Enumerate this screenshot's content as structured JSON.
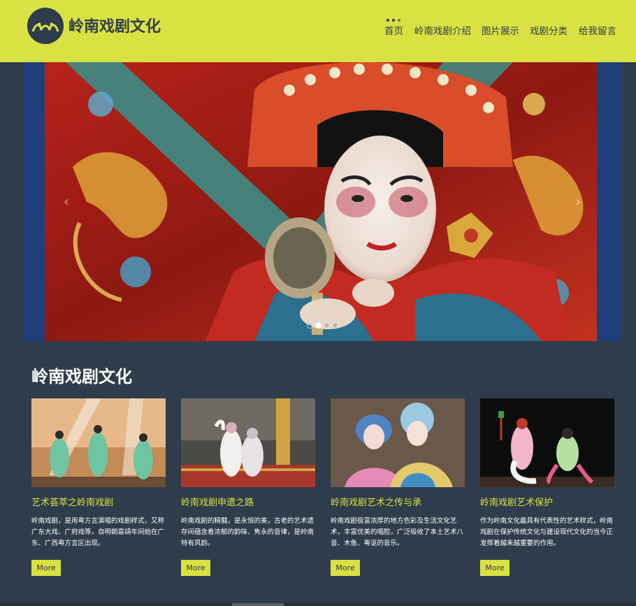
{
  "site": {
    "title": "岭南戏剧文化"
  },
  "nav": {
    "items": [
      "首页",
      "岭南戏剧介绍",
      "图片展示",
      "戏剧分类",
      "给我留言"
    ]
  },
  "banner": {
    "prev_icon": "‹",
    "next_icon": "›",
    "slide_count": 4,
    "active_slide": 2
  },
  "section": {
    "title": "岭南戏剧文化"
  },
  "cards": [
    {
      "title": "艺术荟萃之岭南戏剧",
      "text": "岭南戏剧，是用粤方言演唱的戏剧样式，又称广东大戏、广府戏等，自明朝嘉靖年间始在广东、广西粤方言区出现。",
      "button": "More"
    },
    {
      "title": "岭南戏剧申遗之路",
      "text": "岭南戏剧的精髓，是永恒的美，古老的艺术遗存间蕴含着浓郁的韵味、隽永的音律，是岭南特有风韵。",
      "button": "More"
    },
    {
      "title": "岭南戏剧艺术之传与承",
      "text": "岭南戏剧极富浓厚的地方色彩及生活文化艺术，丰富优美的唱腔，广泛吸收了本土艺术八音、木鱼、粤讴的音乐。",
      "button": "More"
    },
    {
      "title": "岭南戏剧艺术保护",
      "text": "作为岭南文化最具有代表性的艺术样式，岭南戏剧在保护传统文化与建设现代文化的当今正发挥着越来越重要的作用。",
      "button": "More"
    }
  ],
  "colors": {
    "accent": "#d9e242",
    "dark": "#2f3c4b"
  }
}
